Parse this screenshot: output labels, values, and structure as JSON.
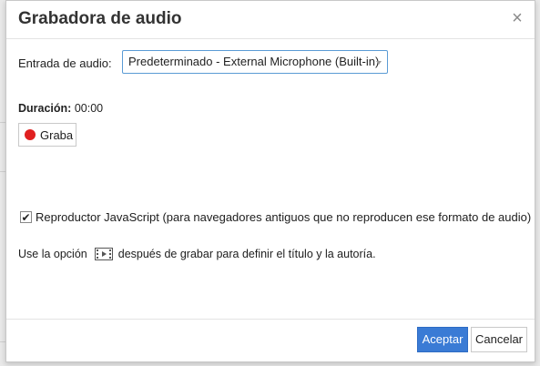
{
  "dialog": {
    "title": "Grabadora de audio",
    "close_icon": "close-icon"
  },
  "audio_input": {
    "label": "Entrada de audio:",
    "selected": "Predeterminado - External Microphone (Built-in)"
  },
  "duration": {
    "label": "Duración:",
    "value": "00:00"
  },
  "record_button": {
    "label": "Graba",
    "icon": "record-dot-icon",
    "icon_color": "#e02020"
  },
  "js_player": {
    "checked": true,
    "label": "Reproductor JavaScript (para navegadores antiguos que no reproducen ese formato de audio)"
  },
  "hint": {
    "before": "Use la opción",
    "icon": "media-film-icon",
    "after": "después de grabar para definir el título y la autoría."
  },
  "footer": {
    "accept_label": "Aceptar",
    "cancel_label": "Cancelar",
    "accent_color": "#3a7bd5"
  }
}
